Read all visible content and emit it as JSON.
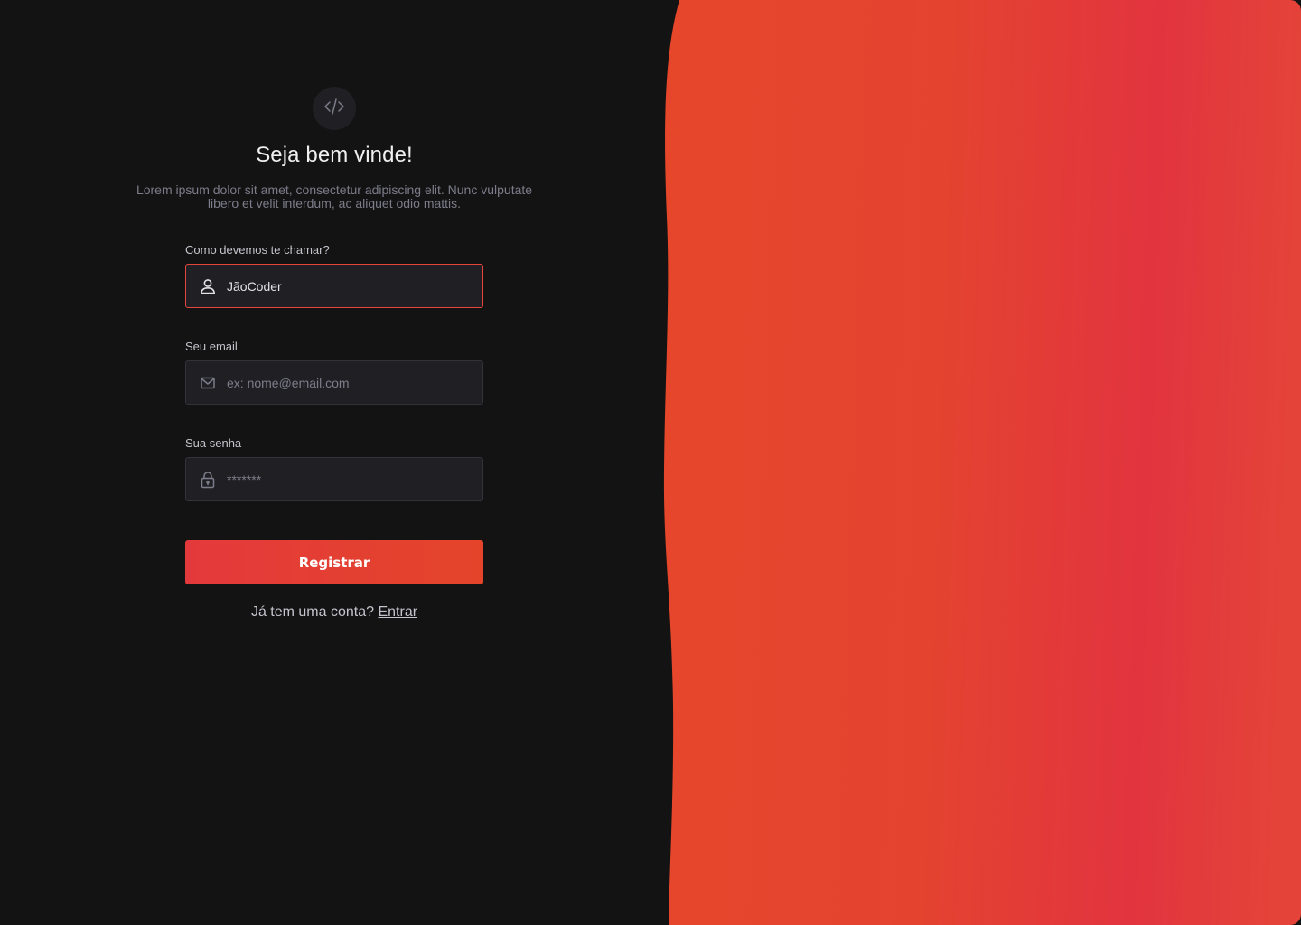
{
  "header": {
    "logo_icon": "code-icon",
    "title": "Seja bem vinde!",
    "subtitle": "Lorem ipsum dolor sit amet, consectetur adipiscing elit. Nunc vulputate libero et velit interdum, ac aliquet odio mattis."
  },
  "form": {
    "name": {
      "label": "Como devemos te chamar?",
      "value": "JãoCoder",
      "placeholder": "",
      "icon": "user-icon"
    },
    "email": {
      "label": "Seu email",
      "value": "",
      "placeholder": "ex: nome@email.com",
      "icon": "mail-icon"
    },
    "password": {
      "label": "Sua senha",
      "value": "",
      "placeholder": "*******",
      "icon": "lock-icon"
    },
    "submit_label": "Registrar"
  },
  "footer": {
    "prompt": "Já tem uma conta?",
    "link": "Entrar"
  },
  "colors": {
    "background": "#131313",
    "input_background": "#202024",
    "input_border": "#323238",
    "accent": "#e4453a",
    "gradient_start": "#e6472b",
    "gradient_end": "#e2343f"
  }
}
